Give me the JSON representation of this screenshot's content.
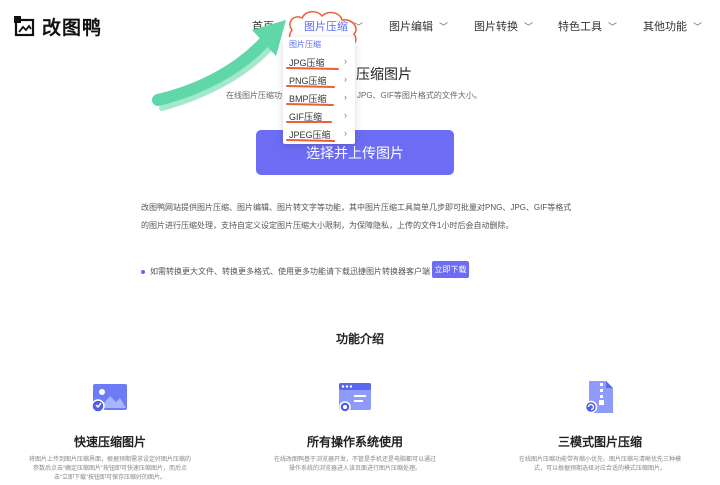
{
  "header": {
    "logo_text": "改图鸭",
    "nav": [
      {
        "label": "首页"
      },
      {
        "label": "图片压缩",
        "active": true
      },
      {
        "label": "图片编辑"
      },
      {
        "label": "图片转换"
      },
      {
        "label": "特色工具"
      },
      {
        "label": "其他功能"
      }
    ],
    "chevron": "﹀"
  },
  "dropdown": {
    "header": "图片压缩",
    "items": [
      "JPG压缩",
      "PNG压缩",
      "BMP压缩",
      "GIF压缩",
      "JPEG压缩"
    ],
    "arrow": "›"
  },
  "hero": {
    "title": "压缩图片",
    "subtitle_left": "在线图片压缩功",
    "subtitle_right": "JPG、GIF等图片格式的文件大小。",
    "upload_button": "选择并上传图片"
  },
  "description": {
    "line1": "改图鸭网站提供图片压缩、图片编辑、图片转文字等功能，其中图片压缩工具简单几步即可批量对PNG、JPG、GIF等格式",
    "line2": "的图片进行压缩处理，支持自定义设定图片压缩大小限制，为保障隐私，上传的文件1小时后会自动删除。"
  },
  "tip": {
    "text": "如需转换更大文件、转换更多格式、使用更多功能请下载迅捷图片转换器客户端",
    "button": "立即下载"
  },
  "features": {
    "section_title": "功能介绍",
    "items": [
      {
        "title": "快速压缩图片",
        "desc1": "将图片上传到图片压缩界面，根据预期需求设定好图片压缩的",
        "desc2": "参数后点击“确定压缩图片”按钮即可快速压缩图片，而后点",
        "desc3": "击“立即下载”按钮即可保存压缩好的图片。"
      },
      {
        "title": "所有操作系统使用",
        "desc1": "在线改图鸭基于浏览器开发，不管是手机还是电脑都可以通过",
        "desc2": "操作系统的浏览器进入该页面进行图片压缩处理。",
        "desc3": ""
      },
      {
        "title": "三模式图片压缩",
        "desc1": "在线图片压缩功能带有缩小优先、图片压缩与清晰优先三种模",
        "desc2": "式，可以根据预期选择对应合适的模式压缩图片。",
        "desc3": ""
      }
    ]
  },
  "colors": {
    "accent": "#6d6cf5",
    "annotation_green": "#5fd7a8",
    "annotation_red": "#e8603c"
  }
}
